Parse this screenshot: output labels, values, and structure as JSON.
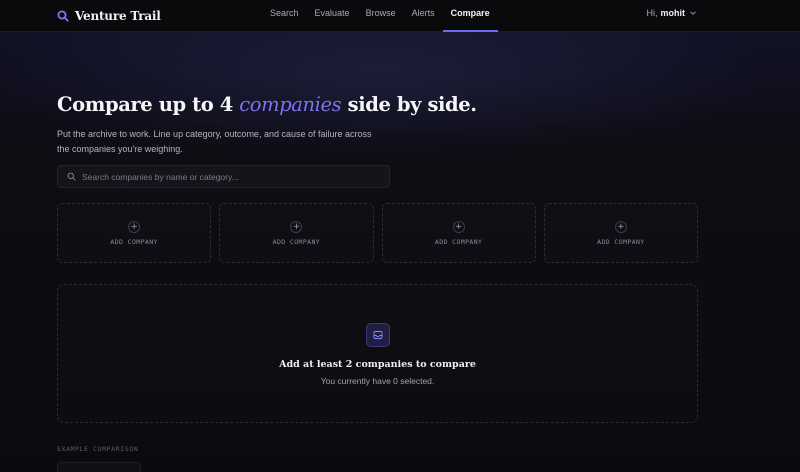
{
  "brand": {
    "name": "Venture Trail",
    "logo_icon": "magnifier-logo-icon",
    "accent_color": "#6f6cf0"
  },
  "nav": {
    "links": [
      {
        "label": "Search",
        "active": false
      },
      {
        "label": "Evaluate",
        "active": false
      },
      {
        "label": "Browse",
        "active": false
      },
      {
        "label": "Alerts",
        "active": false
      },
      {
        "label": "Compare",
        "active": true
      }
    ]
  },
  "user": {
    "greeting": "Hi,",
    "name": "mohit",
    "menu_icon": "chevron-down-icon"
  },
  "hero": {
    "title_before": "Compare up to 4 ",
    "title_accent": "companies",
    "title_after": " side by side.",
    "subtitle": "Put the archive to work. Line up category, outcome, and cause of failure across the companies you're weighing."
  },
  "search": {
    "placeholder": "Search companies by name or category...",
    "value": "",
    "icon": "search-icon"
  },
  "slots": [
    {
      "label": "ADD COMPANY",
      "icon": "plus-icon"
    },
    {
      "label": "ADD COMPANY",
      "icon": "plus-icon"
    },
    {
      "label": "ADD COMPANY",
      "icon": "plus-icon"
    },
    {
      "label": "ADD COMPANY",
      "icon": "plus-icon"
    }
  ],
  "empty_state": {
    "icon": "inbox-icon",
    "title": "Add at least 2 companies to compare",
    "subtitle": "You currently have 0 selected."
  },
  "example": {
    "label": "EXAMPLE COMPARISON"
  }
}
